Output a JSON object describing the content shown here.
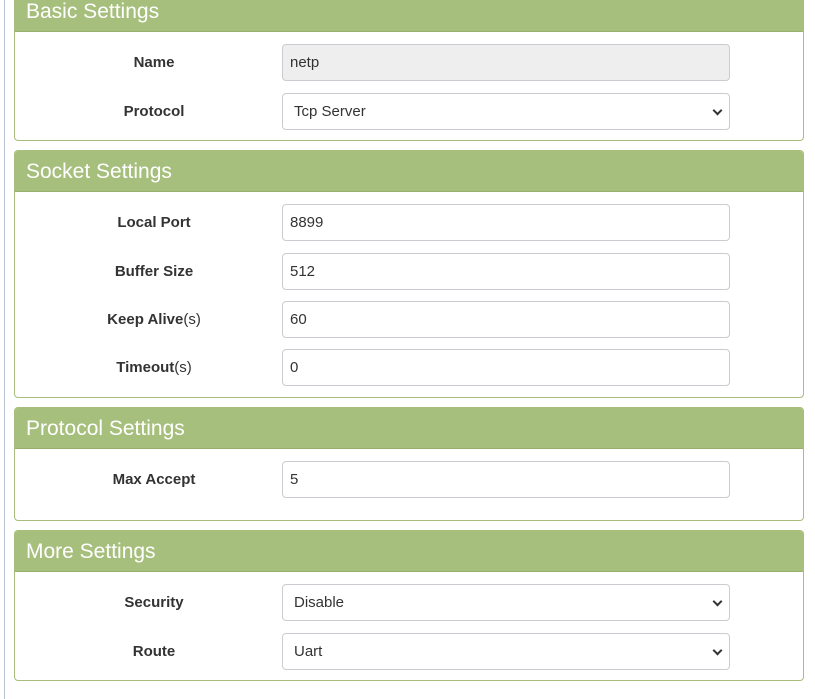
{
  "basic": {
    "title": "Basic Settings",
    "name_label": "Name",
    "name_value": "netp",
    "protocol_label": "Protocol",
    "protocol_value": "Tcp Server"
  },
  "socket": {
    "title": "Socket Settings",
    "local_port_label": "Local Port",
    "local_port_value": "8899",
    "buffer_size_label": "Buffer Size",
    "buffer_size_value": "512",
    "keep_alive_label": "Keep Alive",
    "keep_alive_unit": "(s)",
    "keep_alive_value": "60",
    "timeout_label": "Timeout",
    "timeout_unit": "(s)",
    "timeout_value": "0"
  },
  "protocol": {
    "title": "Protocol Settings",
    "max_accept_label": "Max Accept",
    "max_accept_value": "5"
  },
  "more": {
    "title": "More Settings",
    "security_label": "Security",
    "security_value": "Disable",
    "route_label": "Route",
    "route_value": "Uart"
  },
  "colors": {
    "panel_header": "#a7bf7d",
    "panel_border": "#a9bd7c"
  },
  "icons": {
    "dropdown": "chevron-down-icon"
  }
}
